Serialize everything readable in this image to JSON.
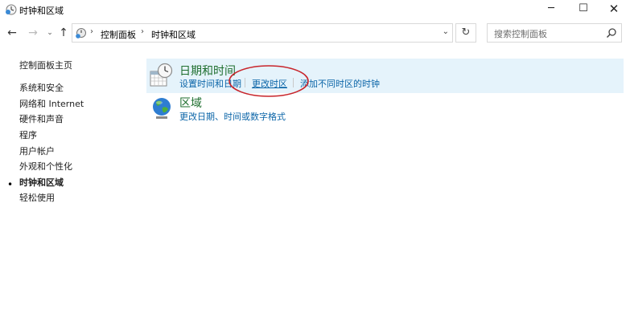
{
  "window": {
    "title": "时钟和区域",
    "minimize_glyph": "─",
    "maximize_glyph": "☐",
    "close_glyph": "✕"
  },
  "nav": {
    "back_glyph": "←",
    "forward_glyph": "→",
    "recent_glyph": "⌄",
    "up_glyph": "↑"
  },
  "address": {
    "breadcrumbs": [
      "控制面板",
      "时钟和区域"
    ],
    "separator": "›",
    "dropdown_glyph": "⌄",
    "refresh_glyph": "↻"
  },
  "search": {
    "placeholder": "搜索控制面板",
    "value": ""
  },
  "sidebar": {
    "items": [
      {
        "label": "控制面板主页",
        "current": false
      },
      {
        "label": "系统和安全",
        "current": false
      },
      {
        "label": "网络和 Internet",
        "current": false
      },
      {
        "label": "硬件和声音",
        "current": false
      },
      {
        "label": "程序",
        "current": false
      },
      {
        "label": "用户帐户",
        "current": false
      },
      {
        "label": "外观和个性化",
        "current": false
      },
      {
        "label": "时钟和区域",
        "current": true
      },
      {
        "label": "轻松使用",
        "current": false
      }
    ],
    "current_marker": "•"
  },
  "main": {
    "categories": [
      {
        "title": "日期和时间",
        "icon": "clock-calendar-icon",
        "links": [
          "设置时间和日期",
          "更改时区",
          "添加不同时区的时钟"
        ]
      },
      {
        "title": "区域",
        "icon": "globe-icon",
        "links": [
          "更改日期、时间或数字格式"
        ]
      }
    ]
  },
  "colors": {
    "accent_link": "#0b65a8",
    "category_title": "#1e6e2e",
    "hover_highlight": "#e5f3fb",
    "annotation_circle": "#c8252b"
  }
}
